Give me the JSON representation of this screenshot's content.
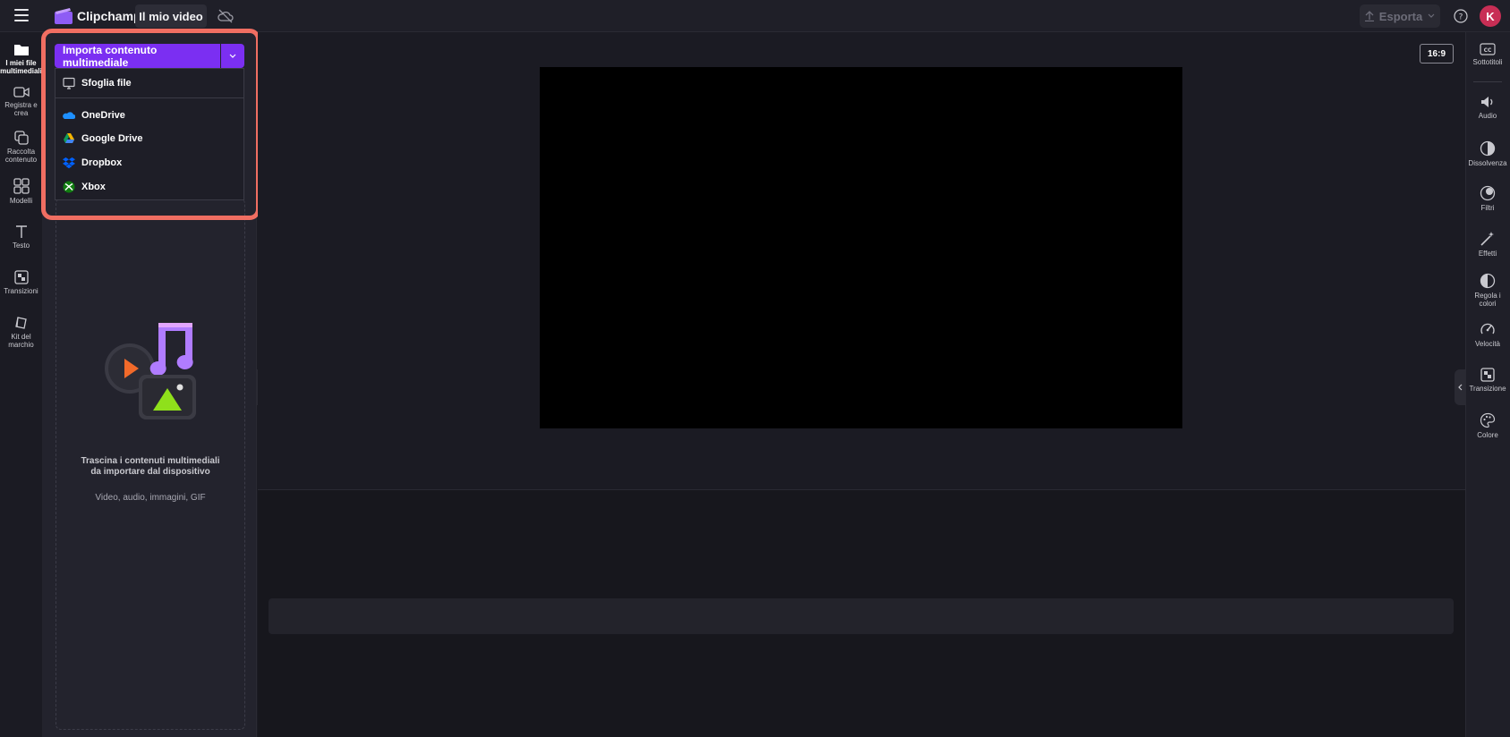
{
  "topbar": {
    "brand": "Clipchamp",
    "video_title": "Il mio video",
    "export_label": "Esporta",
    "avatar_initial": "K"
  },
  "left_rail": {
    "items": [
      {
        "label": "I miei file multimediali",
        "icon": "folder-icon",
        "active": true
      },
      {
        "label": "Registra e crea",
        "icon": "camera-icon"
      },
      {
        "label": "Raccolta contenuto",
        "icon": "library-icon"
      },
      {
        "label": "Modelli",
        "icon": "templates-icon"
      },
      {
        "label": "Testo",
        "icon": "text-icon"
      },
      {
        "label": "Transizioni",
        "icon": "transitions-icon"
      },
      {
        "label": "Kit del marchio",
        "icon": "brand-kit-icon"
      }
    ]
  },
  "media_panel": {
    "import_label": "Importa contenuto multimediale",
    "dropdown": [
      {
        "label": "Sfoglia file",
        "icon": "monitor-icon"
      },
      {
        "label": "OneDrive",
        "icon": "onedrive-icon"
      },
      {
        "label": "Google Drive",
        "icon": "google-drive-icon"
      },
      {
        "label": "Dropbox",
        "icon": "dropbox-icon"
      },
      {
        "label": "Xbox",
        "icon": "xbox-icon"
      }
    ],
    "drop_text": "Trascina i contenuti multimediali da importare dal dispositivo",
    "drop_sub": "Video, audio, immagini, GIF"
  },
  "preview": {
    "aspect_ratio": "16:9"
  },
  "right_rail": {
    "items": [
      {
        "label": "Sottotitoli",
        "icon": "captions-icon"
      },
      {
        "label": "Audio",
        "icon": "speaker-icon"
      },
      {
        "label": "Dissolvenza",
        "icon": "fade-icon"
      },
      {
        "label": "Filtri",
        "icon": "filters-icon"
      },
      {
        "label": "Effetti",
        "icon": "effects-wand-icon"
      },
      {
        "label": "Regola i colori",
        "icon": "adjust-colors-icon"
      },
      {
        "label": "Velocità",
        "icon": "speed-icon"
      },
      {
        "label": "Transizione",
        "icon": "transition-icon"
      },
      {
        "label": "Colore",
        "icon": "palette-icon"
      }
    ]
  },
  "colors": {
    "accent": "#7b2ff2",
    "highlight": "#f06e62",
    "avatar": "#c82e55"
  }
}
